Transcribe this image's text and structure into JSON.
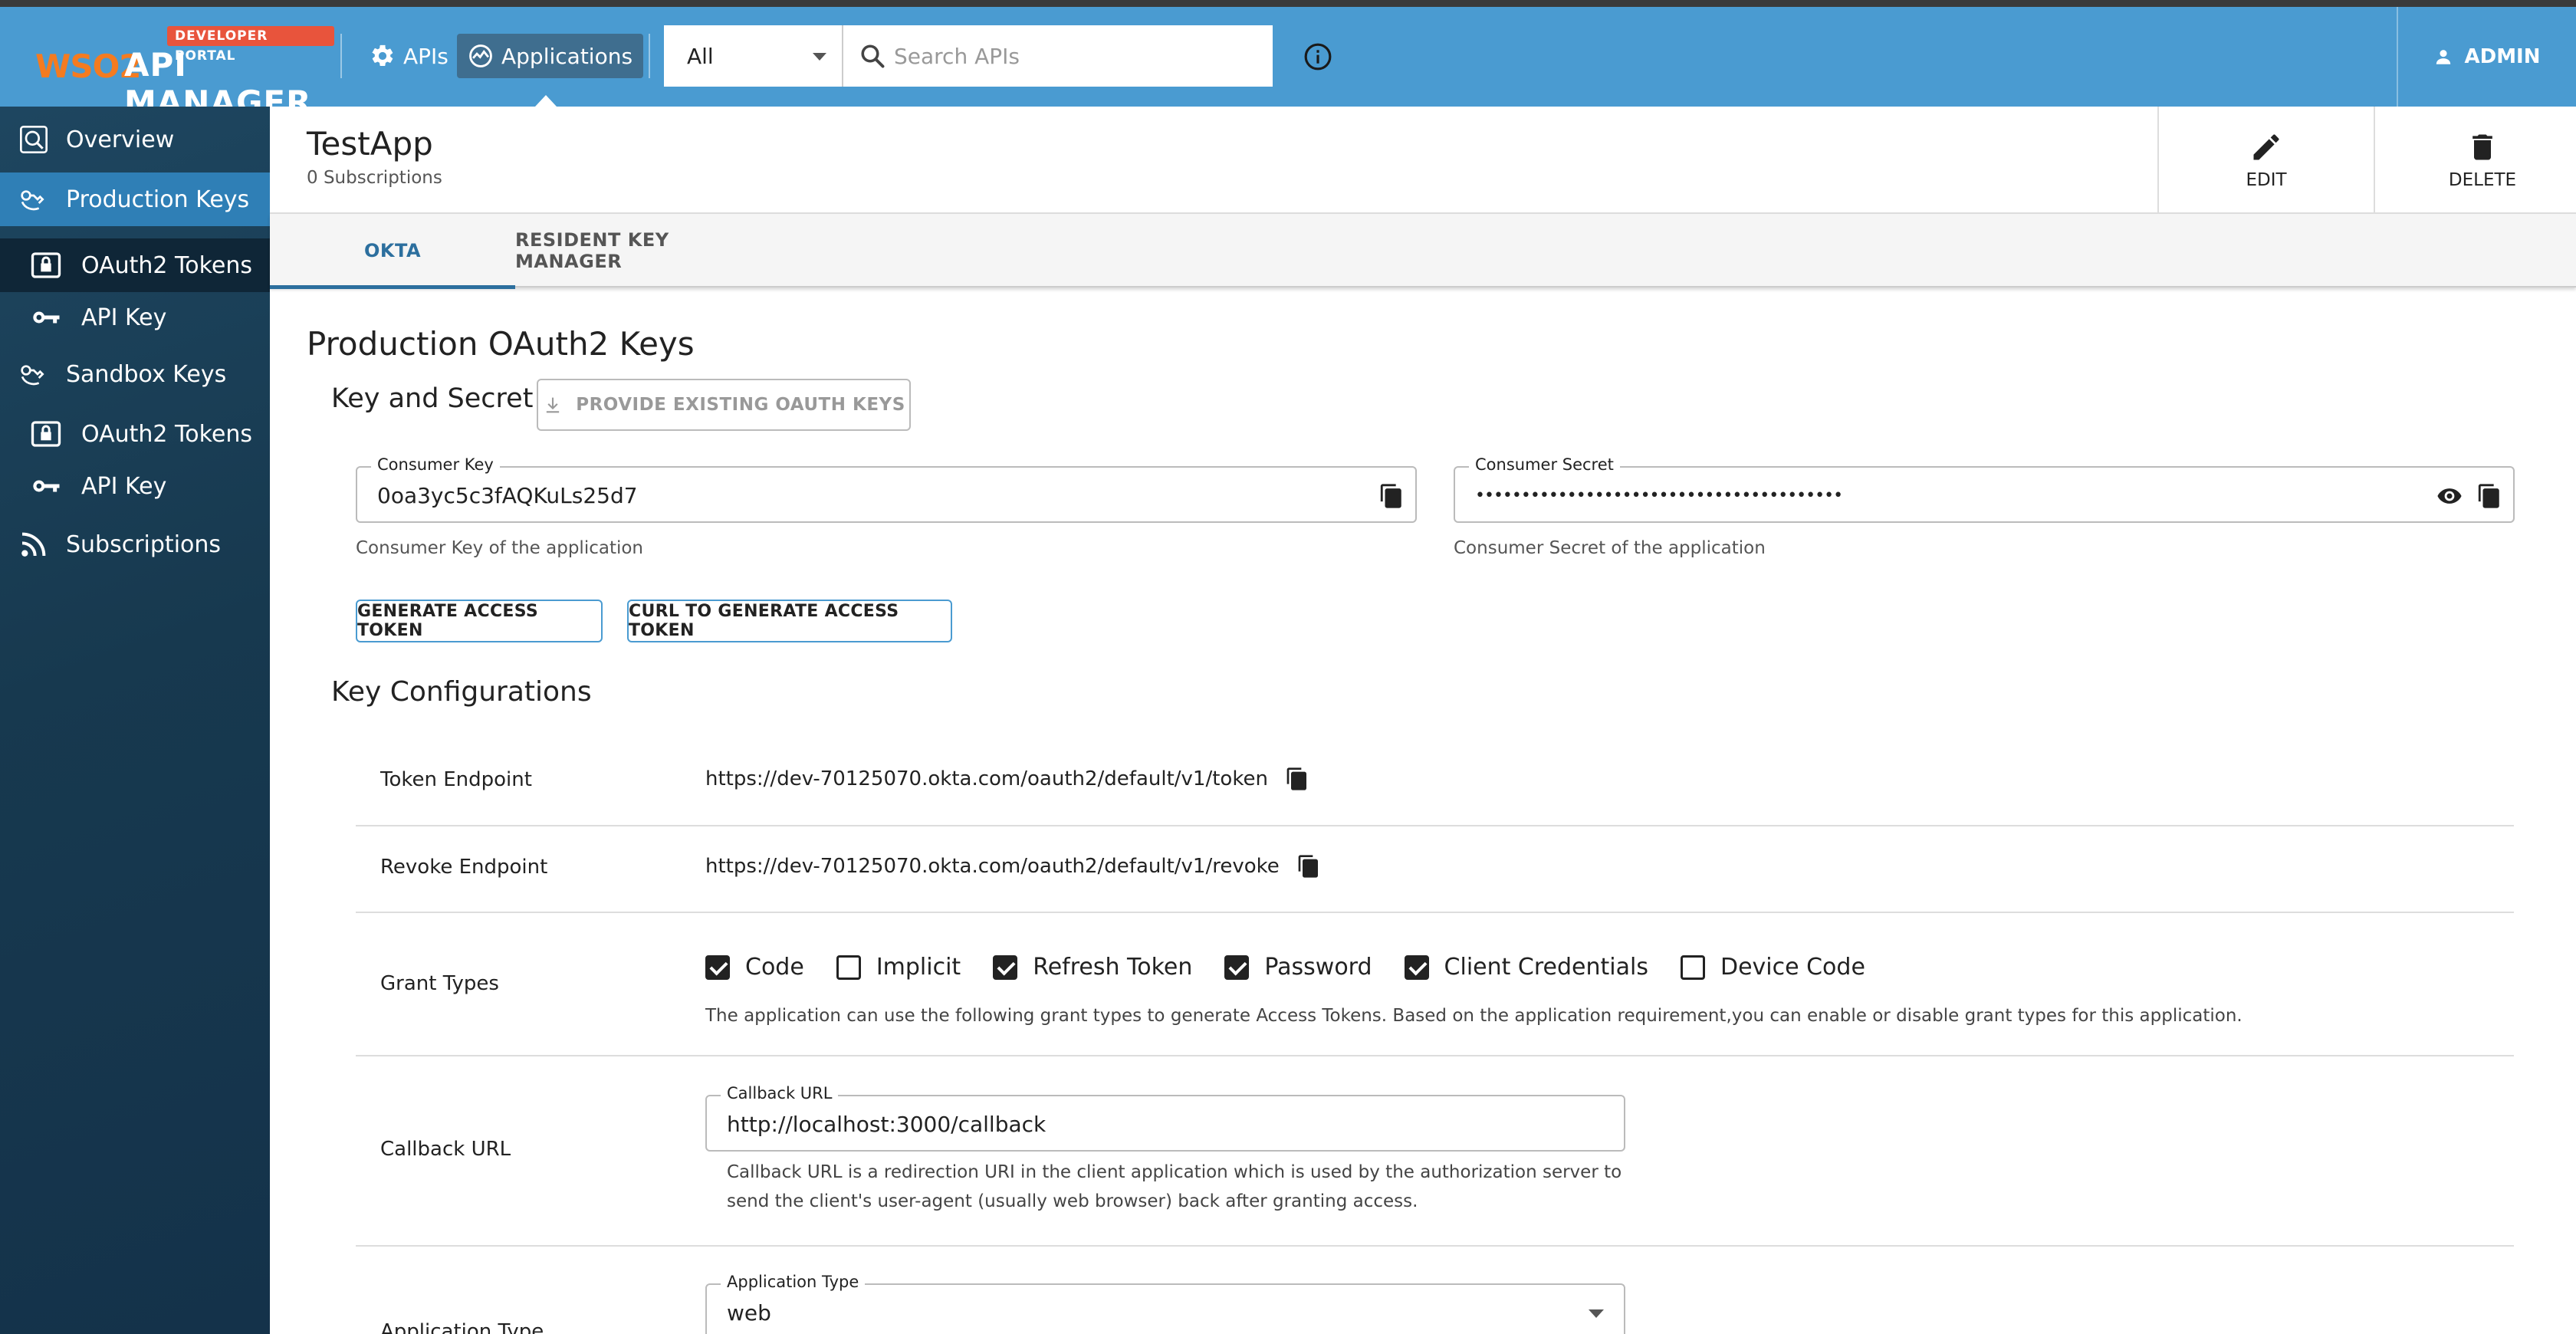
{
  "topbar": {
    "portal_badge": "DEVELOPER PORTAL",
    "logo_wso2": "WSO2",
    "logo_product": "API MANAGER",
    "nav": [
      {
        "label": "APIs",
        "icon": "gear-icon",
        "active": false
      },
      {
        "label": "Applications",
        "icon": "applications-icon",
        "active": true
      }
    ],
    "filter_select_value": "All",
    "search_placeholder": "Search APIs",
    "user_label": "ADMIN"
  },
  "sidebar": {
    "items": [
      {
        "label": "Overview",
        "icon": "overview-icon"
      },
      {
        "label": "Production Keys",
        "icon": "keys-icon"
      },
      {
        "label": "OAuth2 Tokens",
        "icon": "oauth-lock-icon"
      },
      {
        "label": "API Key",
        "icon": "key-icon"
      },
      {
        "label": "Sandbox Keys",
        "icon": "keys-icon"
      },
      {
        "label": "OAuth2 Tokens",
        "icon": "oauth-lock-icon"
      },
      {
        "label": "API Key",
        "icon": "key-icon"
      },
      {
        "label": "Subscriptions",
        "icon": "rss-icon"
      }
    ]
  },
  "header": {
    "app_name": "TestApp",
    "subscriptions": "0 Subscriptions",
    "edit_label": "EDIT",
    "delete_label": "DELETE"
  },
  "tabs": [
    {
      "label": "OKTA",
      "active": true
    },
    {
      "label": "RESIDENT KEY MANAGER",
      "active": false
    }
  ],
  "main": {
    "section_title": "Production OAuth2 Keys",
    "key_secret_title": "Key and Secret",
    "provide_keys_button": "PROVIDE EXISTING OAUTH KEYS",
    "consumer_key": {
      "label": "Consumer Key",
      "value": "0oa3yc5c3fAQKuLs25d7",
      "helper": "Consumer Key of the application"
    },
    "consumer_secret": {
      "label": "Consumer Secret",
      "value": "••••••••••••••••••••••••••••••••••••••••",
      "helper": "Consumer Secret of the application"
    },
    "generate_token_button": "GENERATE ACCESS TOKEN",
    "curl_button": "CURL TO GENERATE ACCESS TOKEN",
    "key_config_title": "Key Configurations",
    "token_endpoint": {
      "label": "Token Endpoint",
      "value": "https://dev-70125070.okta.com/oauth2/default/v1/token"
    },
    "revoke_endpoint": {
      "label": "Revoke Endpoint",
      "value": "https://dev-70125070.okta.com/oauth2/default/v1/revoke"
    },
    "grant_types": {
      "label": "Grant Types",
      "options": [
        {
          "label": "Code",
          "checked": true
        },
        {
          "label": "Implicit",
          "checked": false
        },
        {
          "label": "Refresh Token",
          "checked": true
        },
        {
          "label": "Password",
          "checked": true
        },
        {
          "label": "Client Credentials",
          "checked": true
        },
        {
          "label": "Device Code",
          "checked": false
        }
      ],
      "helper": "The application can use the following grant types to generate Access Tokens. Based on the application requirement,you can enable or disable grant types for this application."
    },
    "callback_url": {
      "row_label": "Callback URL",
      "field_label": "Callback URL",
      "value": "http://localhost:3000/callback",
      "helper": "Callback URL is a redirection URI in the client application which is used by the authorization server to send the client's user-agent (usually web browser) back after granting access."
    },
    "application_type": {
      "row_label": "Application Type",
      "field_label": "Application Type",
      "value": "web"
    }
  },
  "colors": {
    "topbar": "#4a9bd1",
    "sidebar": "#17394f",
    "sidebar_selected_parent": "#2f7fb6",
    "accent": "#2c6f9e",
    "badge": "#e8543c"
  }
}
